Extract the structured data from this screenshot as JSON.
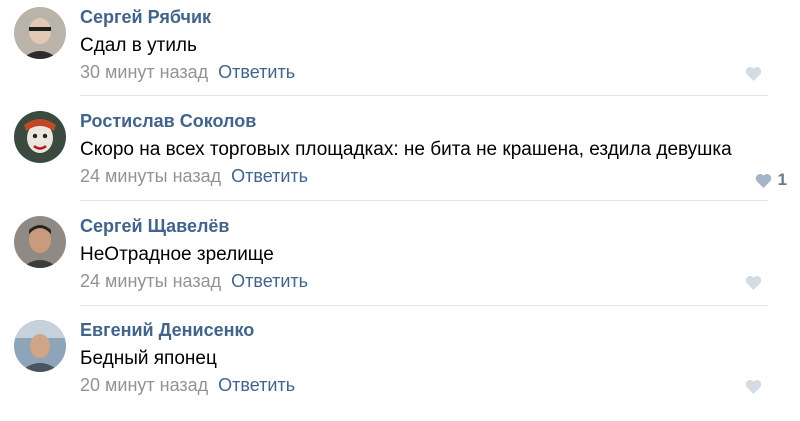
{
  "comments": [
    {
      "author": "Сергей Рябчик",
      "text": "Сдал в утиль",
      "time": "30 минут назад",
      "reply": "Ответить",
      "likes": "",
      "like_icon": "heart-icon",
      "heart_color": "#d4dbe3"
    },
    {
      "author": "Ростислав Соколов",
      "text": "Скоро на всех торговых площадках: не бита не крашена, ездила девушка",
      "time": "24 минуты назад",
      "reply": "Ответить",
      "likes": "1",
      "like_icon": "heart-icon",
      "heart_color": "#a5b5c7"
    },
    {
      "author": "Сергей Щавелёв",
      "text": "НеОтрадное зрелище",
      "time": "24 минуты назад",
      "reply": "Ответить",
      "likes": "",
      "like_icon": "heart-icon",
      "heart_color": "#d4dbe3"
    },
    {
      "author": "Евгений Денисенко",
      "text": "Бедный японец",
      "time": "20 минут назад",
      "reply": "Ответить",
      "likes": "",
      "like_icon": "heart-icon",
      "heart_color": "#d4dbe3"
    }
  ],
  "colors": {
    "author": "#42648b",
    "reply": "#42648b",
    "meta": "#939393",
    "divider": "#e1e4e8"
  }
}
